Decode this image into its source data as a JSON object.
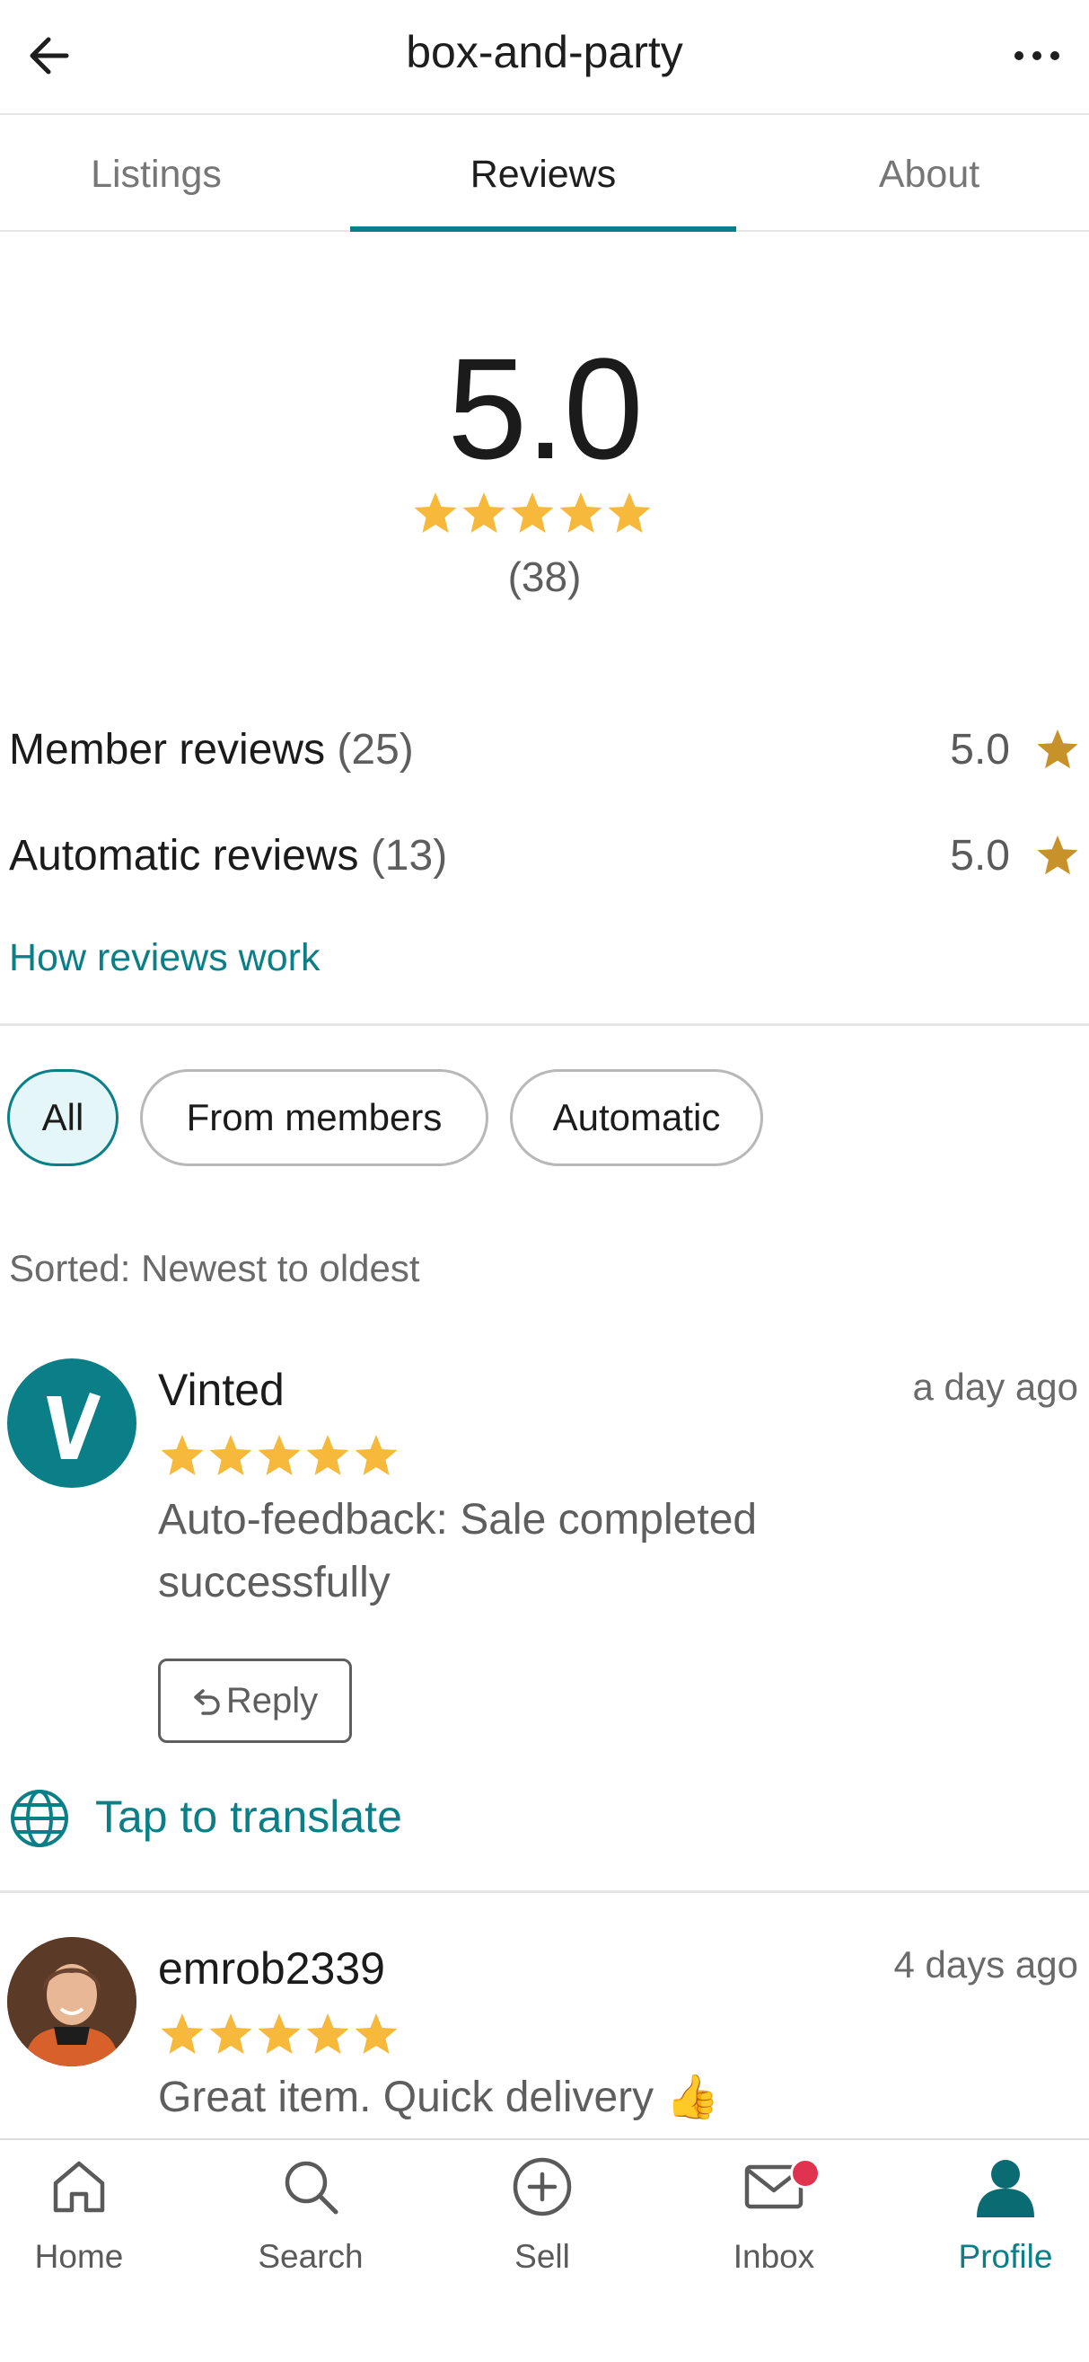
{
  "header": {
    "title": "box-and-party",
    "back_icon": "back-arrow-icon",
    "more_icon": "more-dots-icon"
  },
  "tabs": [
    {
      "label": "Listings",
      "active": false
    },
    {
      "label": "Reviews",
      "active": true
    },
    {
      "label": "About",
      "active": false
    }
  ],
  "summary": {
    "rating": "5.0",
    "stars": 5,
    "count": "(38)"
  },
  "breakdown": {
    "member": {
      "label": "Member reviews",
      "count": "(25)",
      "score": "5.0"
    },
    "automatic": {
      "label": "Automatic reviews",
      "count": "(13)",
      "score": "5.0"
    }
  },
  "how_link": "How reviews work",
  "filters": [
    {
      "label": "All",
      "active": true
    },
    {
      "label": "From members",
      "active": false
    },
    {
      "label": "Automatic",
      "active": false
    }
  ],
  "sorted_label": "Sorted: Newest to oldest",
  "reviews": [
    {
      "reviewer": "Vinted",
      "time": "a day ago",
      "stars": 5,
      "text": "Auto-feedback: Sale completed successfully",
      "reply_label": "Reply",
      "translate_label": "Tap to translate"
    },
    {
      "reviewer": "emrob2339",
      "time": "4 days ago",
      "stars": 5,
      "text": "Great item. Quick delivery 👍"
    }
  ],
  "bottom_nav": [
    {
      "label": "Home",
      "icon": "home-icon",
      "active": false
    },
    {
      "label": "Search",
      "icon": "search-icon",
      "active": false
    },
    {
      "label": "Sell",
      "icon": "plus-circle-icon",
      "active": false
    },
    {
      "label": "Inbox",
      "icon": "mail-icon",
      "active": false,
      "badge": true
    },
    {
      "label": "Profile",
      "icon": "person-icon",
      "active": true
    }
  ],
  "colors": {
    "accent": "#0a7f88",
    "star_rating": "#f6b93b",
    "star_breakdown": "#c8922b",
    "badge": "#e0334f"
  }
}
